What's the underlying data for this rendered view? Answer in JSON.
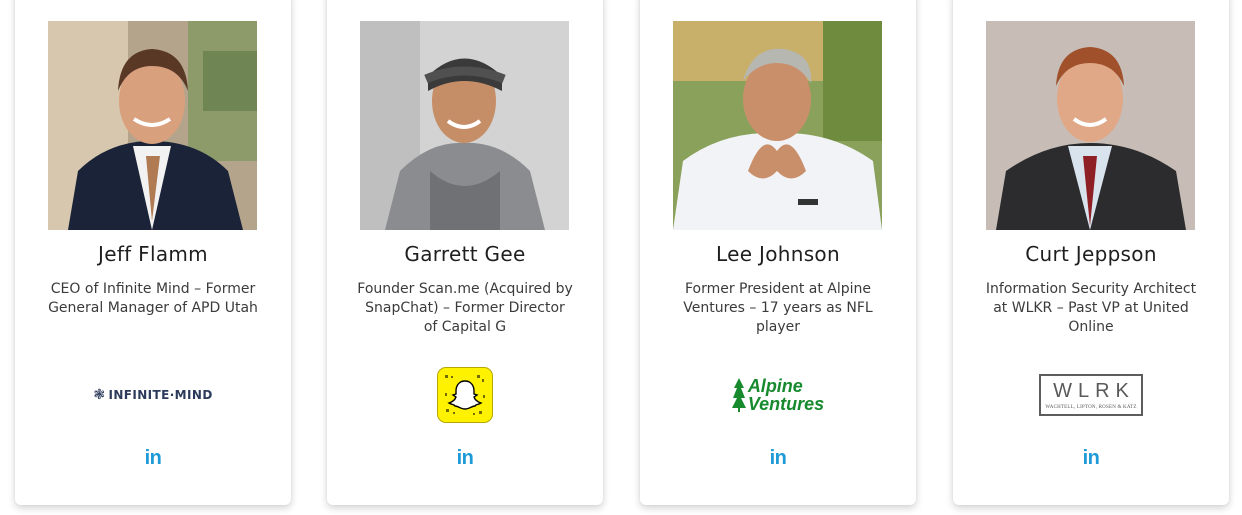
{
  "team": [
    {
      "name": "Jeff Flamm",
      "bio": "CEO of Infinite Mind – Former General Manager of APD Utah",
      "logo_text": "INFINITE·MIND",
      "logo_icon": "infinite-mind-logo",
      "linkedin_label": "in"
    },
    {
      "name": "Garrett Gee",
      "bio": "Founder Scan.me (Acquired by SnapChat) – Former Director of Capital G",
      "logo_icon": "snapchat-logo",
      "linkedin_label": "in"
    },
    {
      "name": "Lee Johnson",
      "bio": "Former President at Alpine Ventures – 17 years as NFL player",
      "logo_text_1": "Alpine",
      "logo_text_2": "Ventures",
      "logo_icon": "alpine-ventures-logo",
      "linkedin_label": "in"
    },
    {
      "name": "Curt Jeppson",
      "bio": "Information Security Architect at WLKR – Past VP at United Online",
      "logo_text": "WLRK",
      "logo_subtext": "WACHTELL, LIPTON, ROSEN & KATZ",
      "logo_icon": "wlrk-logo",
      "linkedin_label": "in"
    }
  ],
  "colors": {
    "linkedin": "#1e9ad6",
    "name_text": "#1f1f1f",
    "bio_text": "#3b3b3b",
    "snapchat_yellow": "#fff200",
    "alpine_green": "#178a2e"
  }
}
